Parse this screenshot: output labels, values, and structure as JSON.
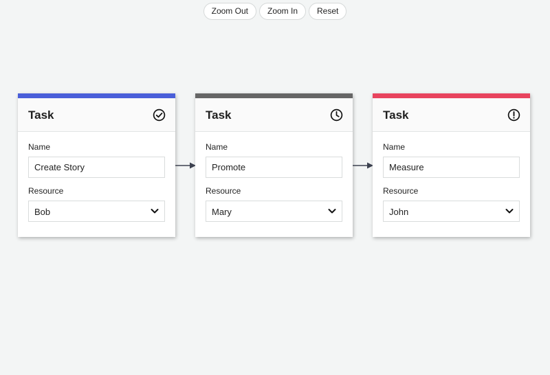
{
  "toolbar": {
    "zoom_out_label": "Zoom Out",
    "zoom_in_label": "Zoom In",
    "reset_label": "Reset"
  },
  "cards": [
    {
      "title": "Task",
      "status_icon": "check-circle-icon",
      "accent_color": "#4a5fd9",
      "name_label": "Name",
      "name_value": "Create Story",
      "resource_label": "Resource",
      "resource_value": "Bob"
    },
    {
      "title": "Task",
      "status_icon": "clock-icon",
      "accent_color": "#666666",
      "name_label": "Name",
      "name_value": "Promote",
      "resource_label": "Resource",
      "resource_value": "Mary"
    },
    {
      "title": "Task",
      "status_icon": "alert-circle-icon",
      "accent_color": "#e8445e",
      "name_label": "Name",
      "name_value": "Measure",
      "resource_label": "Resource",
      "resource_value": "John"
    }
  ],
  "connector_color": "#3d4250"
}
